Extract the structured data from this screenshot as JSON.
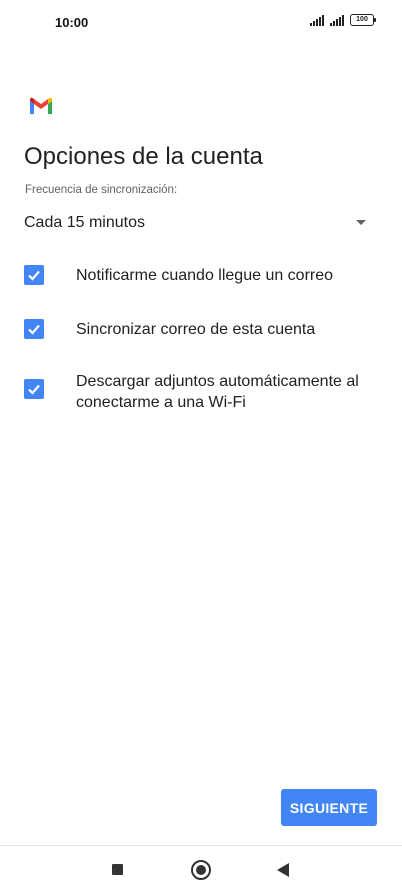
{
  "status_bar": {
    "time": "10:00",
    "battery": "100"
  },
  "app": {
    "logo_icon": "gmail-logo"
  },
  "page": {
    "title": "Opciones de la cuenta"
  },
  "sync": {
    "label": "Frecuencia de sincronización:",
    "selected": "Cada 15 minutos"
  },
  "options": [
    {
      "label": "Notificarme cuando llegue un correo",
      "checked": true
    },
    {
      "label": "Sincronizar correo de esta cuenta",
      "checked": true
    },
    {
      "label": "Descargar adjuntos automáticamente al conectarme a una Wi-Fi",
      "checked": true
    }
  ],
  "actions": {
    "next_label": "SIGUIENTE"
  },
  "colors": {
    "accent": "#4285f4",
    "text": "#202124",
    "secondary_text": "#5f6368"
  }
}
